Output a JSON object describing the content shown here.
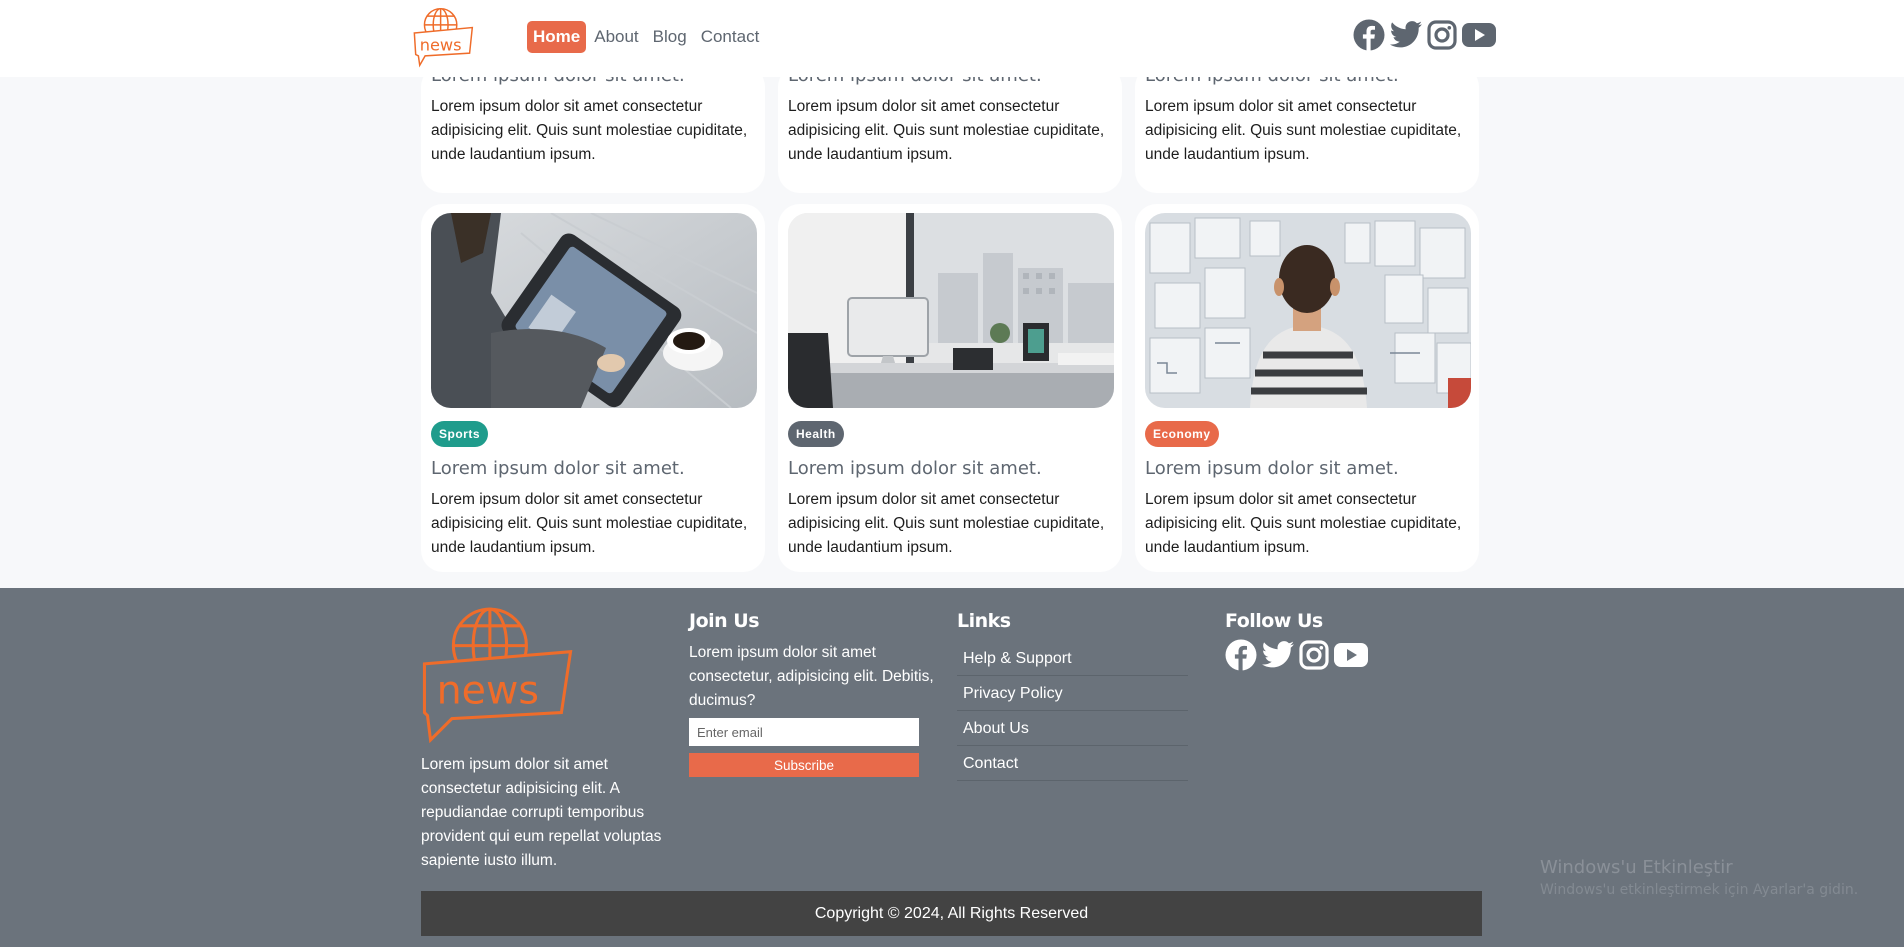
{
  "brand": {
    "logo_text": "news",
    "accent": "#e86a4a",
    "logo_color": "#ef6c2a"
  },
  "nav": {
    "items": [
      {
        "label": "Home",
        "active": true
      },
      {
        "label": "About",
        "active": false
      },
      {
        "label": "Blog",
        "active": false
      },
      {
        "label": "Contact",
        "active": false
      }
    ]
  },
  "social": [
    "facebook-icon",
    "twitter-icon",
    "instagram-icon",
    "youtube-icon"
  ],
  "cards_top": [
    {
      "title": "Lorem ipsum dolor sit amet.",
      "text": "Lorem ipsum dolor sit amet consectetur adipisicing elit. Quis sunt molestiae cupiditate, unde laudantium ipsum."
    },
    {
      "title": "Lorem ipsum dolor sit amet.",
      "text": "Lorem ipsum dolor sit amet consectetur adipisicing elit. Quis sunt molestiae cupiditate, unde laudantium ipsum."
    },
    {
      "title": "Lorem ipsum dolor sit amet.",
      "text": "Lorem ipsum dolor sit amet consectetur adipisicing elit. Quis sunt molestiae cupiditate, unde laudantium ipsum."
    }
  ],
  "cards": [
    {
      "image": "person-using-tablet-with-coffee",
      "badge": "Sports",
      "badge_color": "#1f9c8c",
      "title": "Lorem ipsum dolor sit amet.",
      "text": "Lorem ipsum dolor sit amet consectetur adipisicing elit. Quis sunt molestiae cupiditate, unde laudantium ipsum."
    },
    {
      "image": "office-desk-with-computer",
      "badge": "Health",
      "badge_color": "#5e6670",
      "title": "Lorem ipsum dolor sit amet.",
      "text": "Lorem ipsum dolor sit amet consectetur adipisicing elit. Quis sunt molestiae cupiditate, unde laudantium ipsum."
    },
    {
      "image": "man-looking-at-wall-of-papers",
      "badge": "Economy",
      "badge_color": "#e86a4a",
      "title": "Lorem ipsum dolor sit amet.",
      "text": "Lorem ipsum dolor sit amet consectetur adipisicing elit. Quis sunt molestiae cupiditate, unde laudantium ipsum."
    }
  ],
  "footer": {
    "about": "Lorem ipsum dolor sit amet consectetur adipisicing elit. A repudiandae corrupti temporibus provident qui eum repellat voluptas sapiente iusto illum.",
    "join_heading": "Join Us",
    "join_text": "Lorem ipsum dolor sit amet consectetur, adipisicing elit. Debitis, ducimus?",
    "email_placeholder": "Enter email",
    "subscribe_label": "Subscribe",
    "links_heading": "Links",
    "links": [
      "Help & Support",
      "Privacy Policy",
      "About Us",
      "Contact"
    ],
    "follow_heading": "Follow Us",
    "copyright": "Copyright © 2024, All Rights Reserved"
  },
  "watermark": {
    "title": "Windows'u Etkinleştir",
    "subtitle": "Windows'u etkinleştirmek için Ayarlar'a gidin."
  }
}
